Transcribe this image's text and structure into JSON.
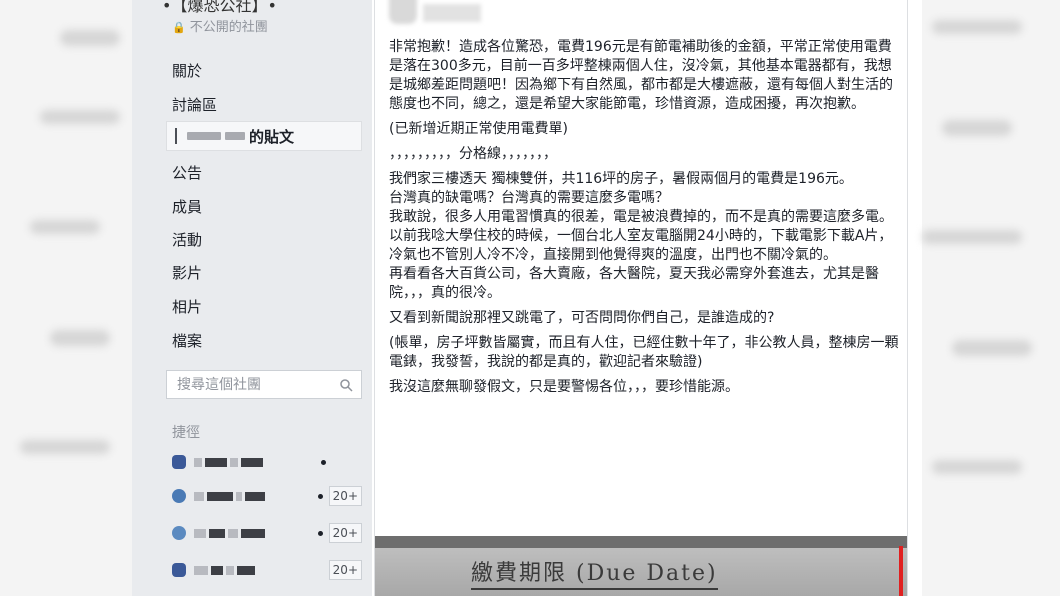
{
  "group": {
    "title": "•【爆恐公社】•",
    "privacy_label": "不公開的社團"
  },
  "nav": {
    "items": [
      {
        "label": "關於"
      },
      {
        "label": "討論區"
      },
      {
        "label": "的貼文",
        "active": true
      },
      {
        "label": "公告"
      },
      {
        "label": "成員"
      },
      {
        "label": "活動"
      },
      {
        "label": "影片"
      },
      {
        "label": "相片"
      },
      {
        "label": "檔案"
      }
    ],
    "search_placeholder": "搜尋這個社團"
  },
  "shortcuts": {
    "label": "捷徑",
    "items": [
      {
        "badge": "",
        "icon": "group-icon",
        "color": "#3b5998"
      },
      {
        "badge": "20+",
        "icon": "group-icon",
        "color": "#4a7ab5"
      },
      {
        "badge": "20+",
        "icon": "group-icon",
        "color": "#5b8ac0"
      },
      {
        "badge": "20+",
        "icon": "group-icon",
        "color": "#3b5998"
      }
    ]
  },
  "post": {
    "paragraphs": [
      "非常抱歉！造成各位驚恐，電費196元是有節電補助後的金額，平常正常使用電費是落在300多元，目前一百多坪整棟兩個人住，沒冷氣，其他基本電器都有，我想是城鄉差距問題吧！因為鄉下有自然風，都市都是大樓遮蔽，還有每個人對生活的態度也不同，總之，還是希望大家能節電，珍惜資源，造成困擾，再次抱歉。",
      "(已新增近期正常使用電費單)",
      "，，，，，，，，，分格線，，，，，，，",
      "我們家三樓透天 獨棟雙併，共116坪的房子，暑假兩個月的電費是196元。",
      "台灣真的缺電嗎？台灣真的需要這麼多電嗎？",
      "我敢說，很多人用電習慣真的很差，電是被浪費掉的，而不是真的需要這麼多電。",
      "以前我唸大學住校的時候，一個台北人室友電腦開24小時的，下載電影下載A片，冷氣也不管別人冷不冷，直接開到他覺得爽的溫度，出門也不關冷氣的。",
      "再看看各大百貨公司，各大賣廠，各大醫院，夏天我必需穿外套進去，尤其是醫院，，，真的很冷。",
      "又看到新聞說那裡又跳電了，可否問問你們自己，是誰造成的?",
      "(帳單，房子坪數皆屬實，而且有人住，已經住數十年了，非公教人員，整棟房一顆電錶，我發誓，我說的都是真的，歡迎記者來驗證)",
      "我沒這麼無聊發假文，只是要警惕各位，，，要珍惜能源。"
    ]
  },
  "receipt": {
    "due_label": "繳費期限 (Due Date)"
  }
}
